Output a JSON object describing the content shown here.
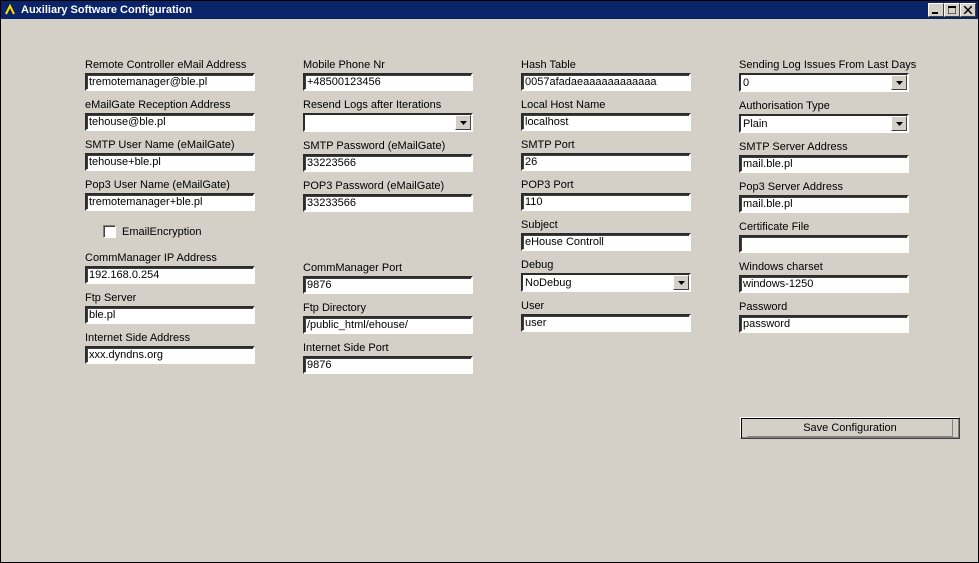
{
  "window": {
    "title": "Auxiliary Software Configuration"
  },
  "col1": {
    "remote_ctrl_email": {
      "label": "Remote Controller eMail Address",
      "value": "tremotemanager@ble.pl"
    },
    "emailgate_recv": {
      "label": "eMailGate Reception Address",
      "value": "tehouse@ble.pl"
    },
    "smtp_user": {
      "label": "SMTP User Name (eMailGate)",
      "value": "tehouse+ble.pl"
    },
    "pop3_user": {
      "label": "Pop3 User Name (eMailGate)",
      "value": "tremotemanager+ble.pl"
    },
    "email_encryption": {
      "label": "EmailEncryption",
      "checked": false
    },
    "commmgr_ip": {
      "label": "CommManager IP Address",
      "value": "192.168.0.254"
    },
    "ftp_server": {
      "label": "Ftp Server",
      "value": "ble.pl"
    },
    "internet_addr": {
      "label": "Internet Side Address",
      "value": "xxx.dyndns.org"
    }
  },
  "col2": {
    "mobile": {
      "label": "Mobile Phone Nr",
      "value": "+48500123456"
    },
    "resend_logs": {
      "label": "Resend Logs after Iterations",
      "value": ""
    },
    "smtp_pass": {
      "label": "SMTP Password (eMailGate)",
      "value": "33223566"
    },
    "pop3_pass": {
      "label": "POP3 Password (eMailGate)",
      "value": "33233566"
    },
    "commmgr_port": {
      "label": "CommManager Port",
      "value": "9876"
    },
    "ftp_dir": {
      "label": "Ftp Directory",
      "value": "/public_html/ehouse/"
    },
    "internet_port": {
      "label": "Internet Side Port",
      "value": "9876"
    }
  },
  "col3": {
    "hash": {
      "label": "Hash Table",
      "value": "0057afadaeaaaaaaaaaaaa"
    },
    "localhost": {
      "label": "Local Host Name",
      "value": "localhost"
    },
    "smtp_port": {
      "label": "SMTP Port",
      "value": "26"
    },
    "pop3_port": {
      "label": "POP3 Port",
      "value": "110"
    },
    "subject": {
      "label": "Subject",
      "value": "eHouse Controll"
    },
    "debug": {
      "label": "Debug",
      "value": "NoDebug"
    },
    "user": {
      "label": "User",
      "value": "user"
    }
  },
  "col4": {
    "log_days": {
      "label": "Sending Log Issues From Last Days",
      "value": "0"
    },
    "auth_type": {
      "label": "Authorisation Type",
      "value": "Plain"
    },
    "smtp_srv": {
      "label": "SMTP Server Address",
      "value": "mail.ble.pl"
    },
    "pop3_srv": {
      "label": "Pop3 Server Address",
      "value": "mail.ble.pl"
    },
    "cert_file": {
      "label": "Certificate File",
      "value": ""
    },
    "charset": {
      "label": "Windows charset",
      "value": "windows-1250"
    },
    "password": {
      "label": "Password",
      "value": "password"
    }
  },
  "actions": {
    "save": "Save Configuration"
  }
}
